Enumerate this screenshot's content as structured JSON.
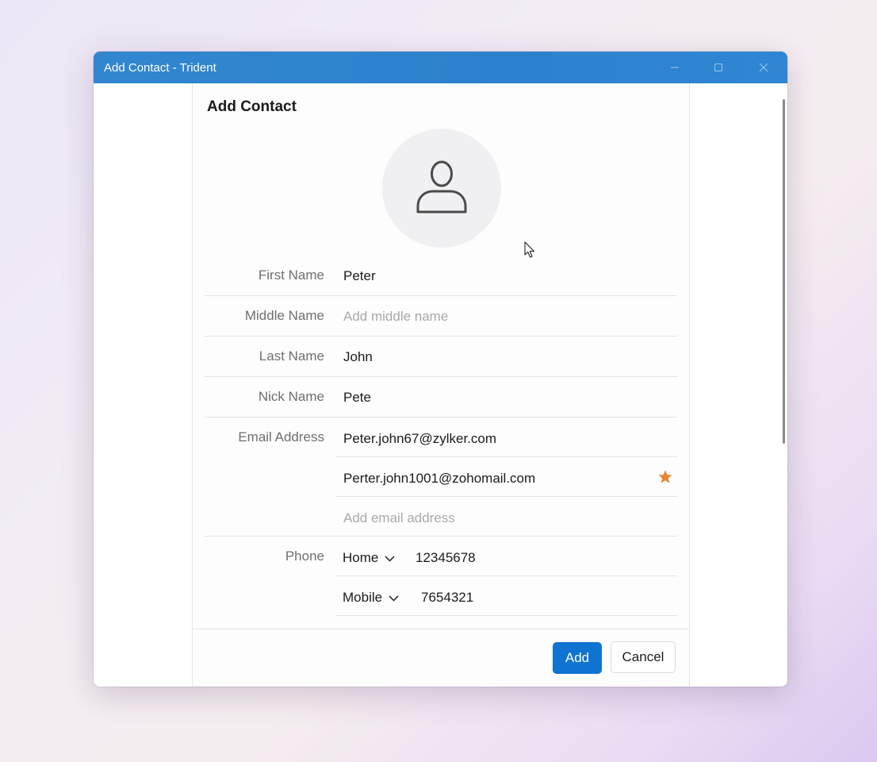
{
  "window": {
    "title": "Add Contact - Trident",
    "controls": [
      "minimize-icon",
      "maximize-icon",
      "close-icon"
    ]
  },
  "form": {
    "heading": "Add Contact",
    "avatar_icon": "person-icon",
    "first_name": {
      "label": "First Name",
      "value": "Peter"
    },
    "middle_name": {
      "label": "Middle Name",
      "placeholder": "Add middle name"
    },
    "last_name": {
      "label": "Last Name",
      "value": "John"
    },
    "nick_name": {
      "label": "Nick Name",
      "value": "Pete"
    },
    "email": {
      "label": "Email Address",
      "addresses": [
        {
          "value": "Peter.john67@zylker.com",
          "starred": false
        },
        {
          "value": "Perter.john1001@zohomail.com",
          "starred": true
        }
      ],
      "add_placeholder": "Add email address"
    },
    "phone": {
      "label": "Phone",
      "entries": [
        {
          "type": "Home",
          "number": "12345678"
        },
        {
          "type": "Mobile",
          "number": "7654321"
        }
      ]
    }
  },
  "buttons": {
    "add_label": "Add",
    "cancel_label": "Cancel"
  },
  "colors": {
    "titlebar": "#2f84cf",
    "accent": "#0f74d2",
    "star": "#e8842e"
  }
}
